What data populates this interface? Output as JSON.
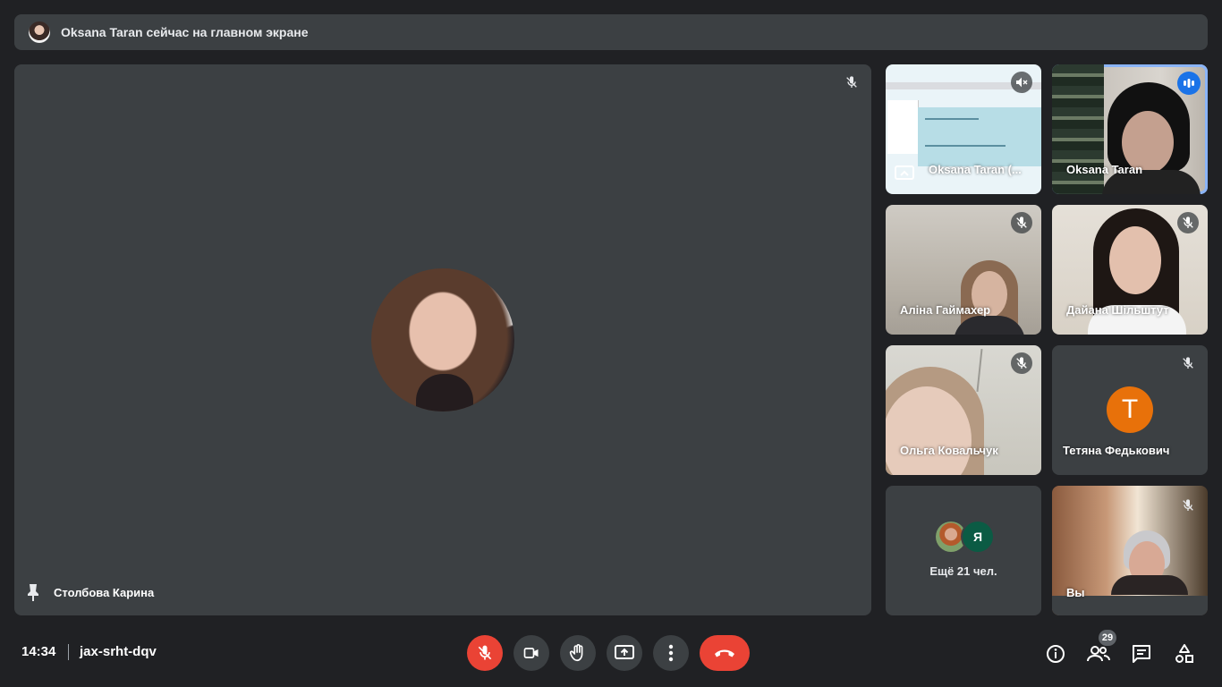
{
  "banner": {
    "text": "Oksana Taran сейчас на главном экране"
  },
  "main": {
    "pinned_name": "Столбова Карина"
  },
  "tiles": [
    {
      "name": "Oksana Taran (..."
    },
    {
      "name": "Oksana Taran"
    },
    {
      "name": "Аліна Гаймахер"
    },
    {
      "name": "Дайана Шільштут"
    },
    {
      "name": "Ольга Ковальчук"
    },
    {
      "name": "Тетяна Федькович",
      "initial": "Т"
    },
    {
      "more_initial": "Я",
      "more_text": "Ещё 21 чел."
    },
    {
      "name": "Вы"
    }
  ],
  "bottom": {
    "time": "14:34",
    "meeting_code": "jax-srht-dqv",
    "participants_count": "29"
  },
  "colors": {
    "background": "#202124",
    "tile": "#3c4043",
    "danger": "#ea4335",
    "speaking": "#8ab4f8",
    "avatar_orange": "#e8710a",
    "avatar_green": "#0b5b44"
  }
}
